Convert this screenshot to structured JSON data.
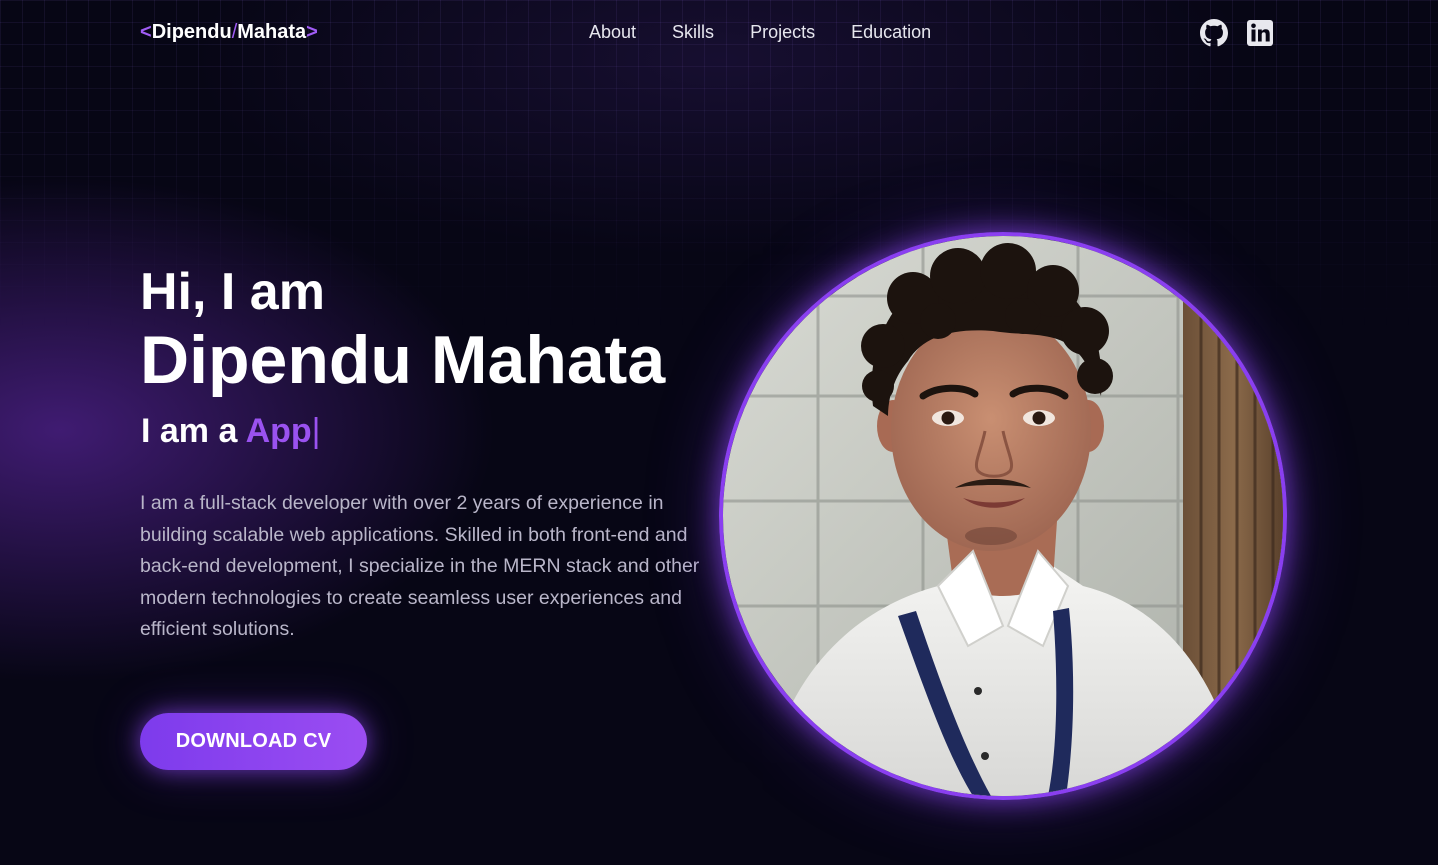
{
  "nav": {
    "logo": {
      "open_bracket": "<",
      "first": "Dipendu",
      "slash": "/",
      "last": "Mahata",
      "close_bracket": ">"
    },
    "links": [
      {
        "label": "About"
      },
      {
        "label": "Skills"
      },
      {
        "label": "Projects"
      },
      {
        "label": "Education"
      }
    ],
    "socials": [
      {
        "icon": "github-icon"
      },
      {
        "icon": "linkedin-icon"
      }
    ]
  },
  "hero": {
    "greeting": "Hi, I am",
    "name": "Dipendu Mahata",
    "role_prefix": "I am a ",
    "role_typed": "App",
    "cursor": "|",
    "bio": "I am a full-stack developer with over 2 years of experience in building scalable web applications. Skilled in both front-end and back-end development, I specialize in the MERN stack and other modern technologies to create seamless user experiences and efficient solutions.",
    "cta_label": "DOWNLOAD CV"
  },
  "colors": {
    "accent": "#9a52f0",
    "background": "#070615",
    "button_gradient_start": "#7d3bec",
    "button_gradient_end": "#9b4df2"
  }
}
